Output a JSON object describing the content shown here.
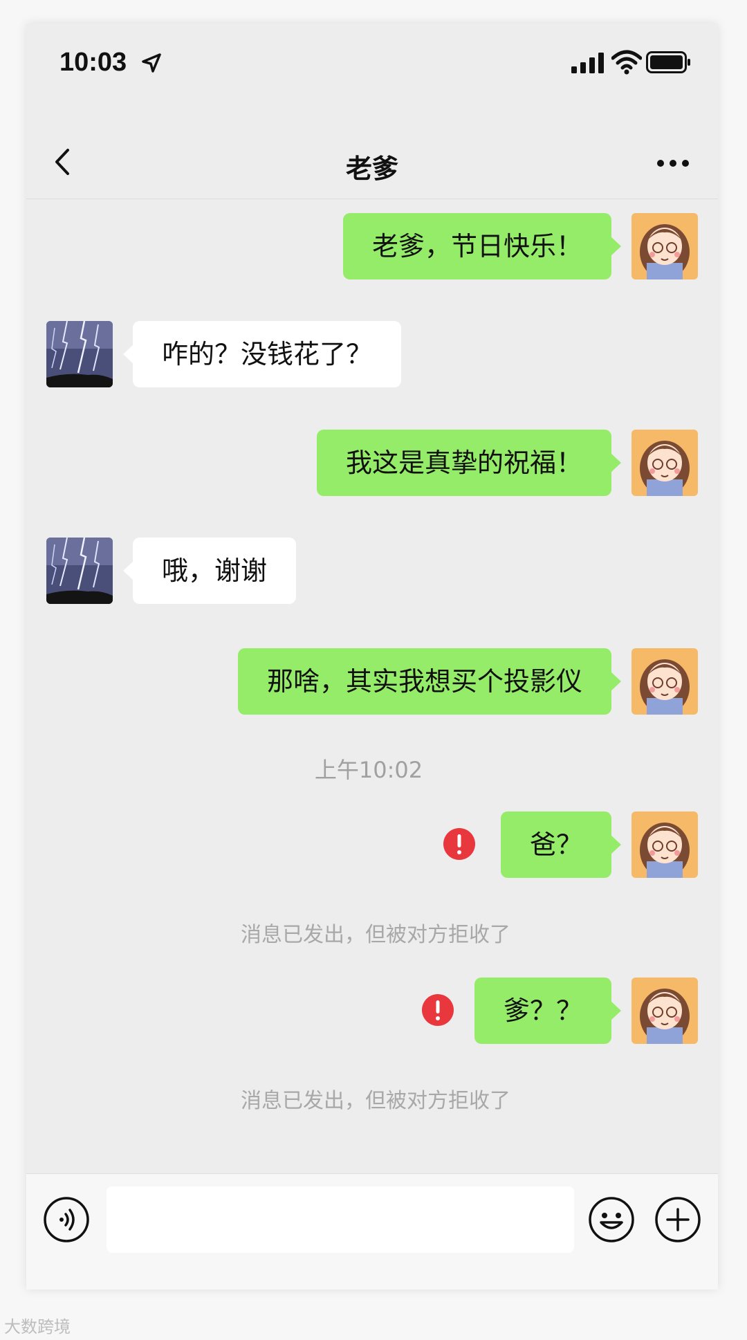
{
  "status_bar": {
    "time": "10:03"
  },
  "nav": {
    "title": "老爹"
  },
  "messages": [
    {
      "direction": "out",
      "text": "老爹，节日快乐！"
    },
    {
      "direction": "in",
      "text": "咋的？没钱花了？"
    },
    {
      "direction": "out",
      "text": "我这是真挚的祝福！"
    },
    {
      "direction": "in",
      "text": "哦，谢谢"
    },
    {
      "direction": "out",
      "text": "那啥，其实我想买个投影仪"
    },
    {
      "type": "timestamp",
      "text": "上午10:02"
    },
    {
      "direction": "out",
      "text": "爸？",
      "failed": true
    },
    {
      "type": "system",
      "text": "消息已发出，但被对方拒收了"
    },
    {
      "direction": "out",
      "text": "爹？？",
      "failed": true
    },
    {
      "type": "system",
      "text": "消息已发出，但被对方拒收了"
    }
  ],
  "input": {
    "value": ""
  },
  "watermark": "大数跨境",
  "colors": {
    "outgoing_bubble": "#95ec69",
    "incoming_bubble": "#ffffff",
    "chat_bg": "#ededed",
    "error": "#e8383d"
  }
}
